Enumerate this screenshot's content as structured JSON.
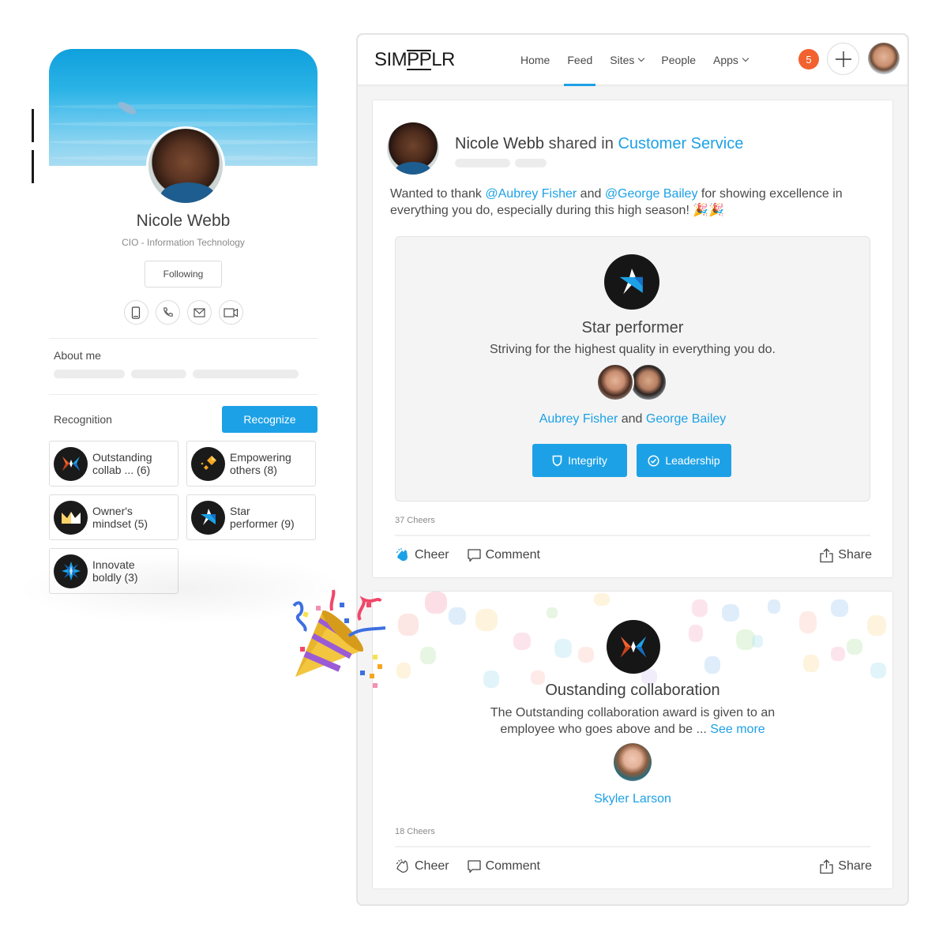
{
  "profile": {
    "name": "Nicole Webb",
    "title": "CIO - Information Technology",
    "follow_label": "Following",
    "contact_icons": [
      "mobile-icon",
      "phone-icon",
      "mail-icon",
      "video-icon"
    ],
    "about_label": "About me",
    "recognition_label": "Recognition",
    "recognize_label": "Recognize",
    "badges": [
      {
        "icon": "collaboration-badge-icon",
        "line1": "Outstanding",
        "line2": "collab ... (6)"
      },
      {
        "icon": "empowering-badge-icon",
        "line1": "Empowering",
        "line2": "others (8)"
      },
      {
        "icon": "crown-badge-icon",
        "line1": "Owner's",
        "line2": "mindset (5)"
      },
      {
        "icon": "star-badge-icon",
        "line1": "Star",
        "line2": "performer (9)"
      },
      {
        "icon": "innovate-badge-icon",
        "line1": "Innovate",
        "line2": "boldly (3)"
      }
    ]
  },
  "app": {
    "logo": {
      "pre": "SIM",
      "mid": "PP",
      "post": "LR"
    },
    "nav": [
      {
        "label": "Home",
        "active": false,
        "dropdown": false
      },
      {
        "label": "Feed",
        "active": true,
        "dropdown": false
      },
      {
        "label": "Sites",
        "active": false,
        "dropdown": true
      },
      {
        "label": "People",
        "active": false,
        "dropdown": false
      },
      {
        "label": "Apps",
        "active": false,
        "dropdown": true
      }
    ],
    "notification_count": "5",
    "colors": {
      "accent": "#1da1e6",
      "notification": "#f2622e",
      "text": "#3b3b3b"
    }
  },
  "posts": [
    {
      "author": "Nicole Webb",
      "shared_text": "shared in",
      "site": "Customer Service",
      "body": {
        "pre": "Wanted to thank ",
        "mention1": "@Aubrey Fisher",
        "mid": " and ",
        "mention2": "@George Bailey",
        "post": " for showing excellence in everything you do, especially during this high season! 🎉🎉"
      },
      "award": {
        "icon": "star-performer-icon",
        "title": "Star performer",
        "description": "Striving for the highest quality in everything you do.",
        "recipient1": "Aubrey Fisher",
        "joiner": " and ",
        "recipient2": "George Bailey",
        "values": [
          {
            "icon": "shield-icon",
            "label": "Integrity"
          },
          {
            "icon": "check-circle-icon",
            "label": "Leadership"
          }
        ]
      },
      "cheers": "37 Cheers",
      "cheered": true,
      "actions": {
        "cheer": "Cheer",
        "comment": "Comment",
        "share": "Share"
      }
    },
    {
      "award": {
        "icon": "collaboration-icon",
        "title": "Oustanding collaboration",
        "description": "The Outstanding collaboration award is given to an employee who goes above and be ... ",
        "see_more": "See more",
        "recipient": "Skyler Larson"
      },
      "cheers": "18 Cheers",
      "cheered": false,
      "actions": {
        "cheer": "Cheer",
        "comment": "Comment",
        "share": "Share"
      }
    }
  ]
}
